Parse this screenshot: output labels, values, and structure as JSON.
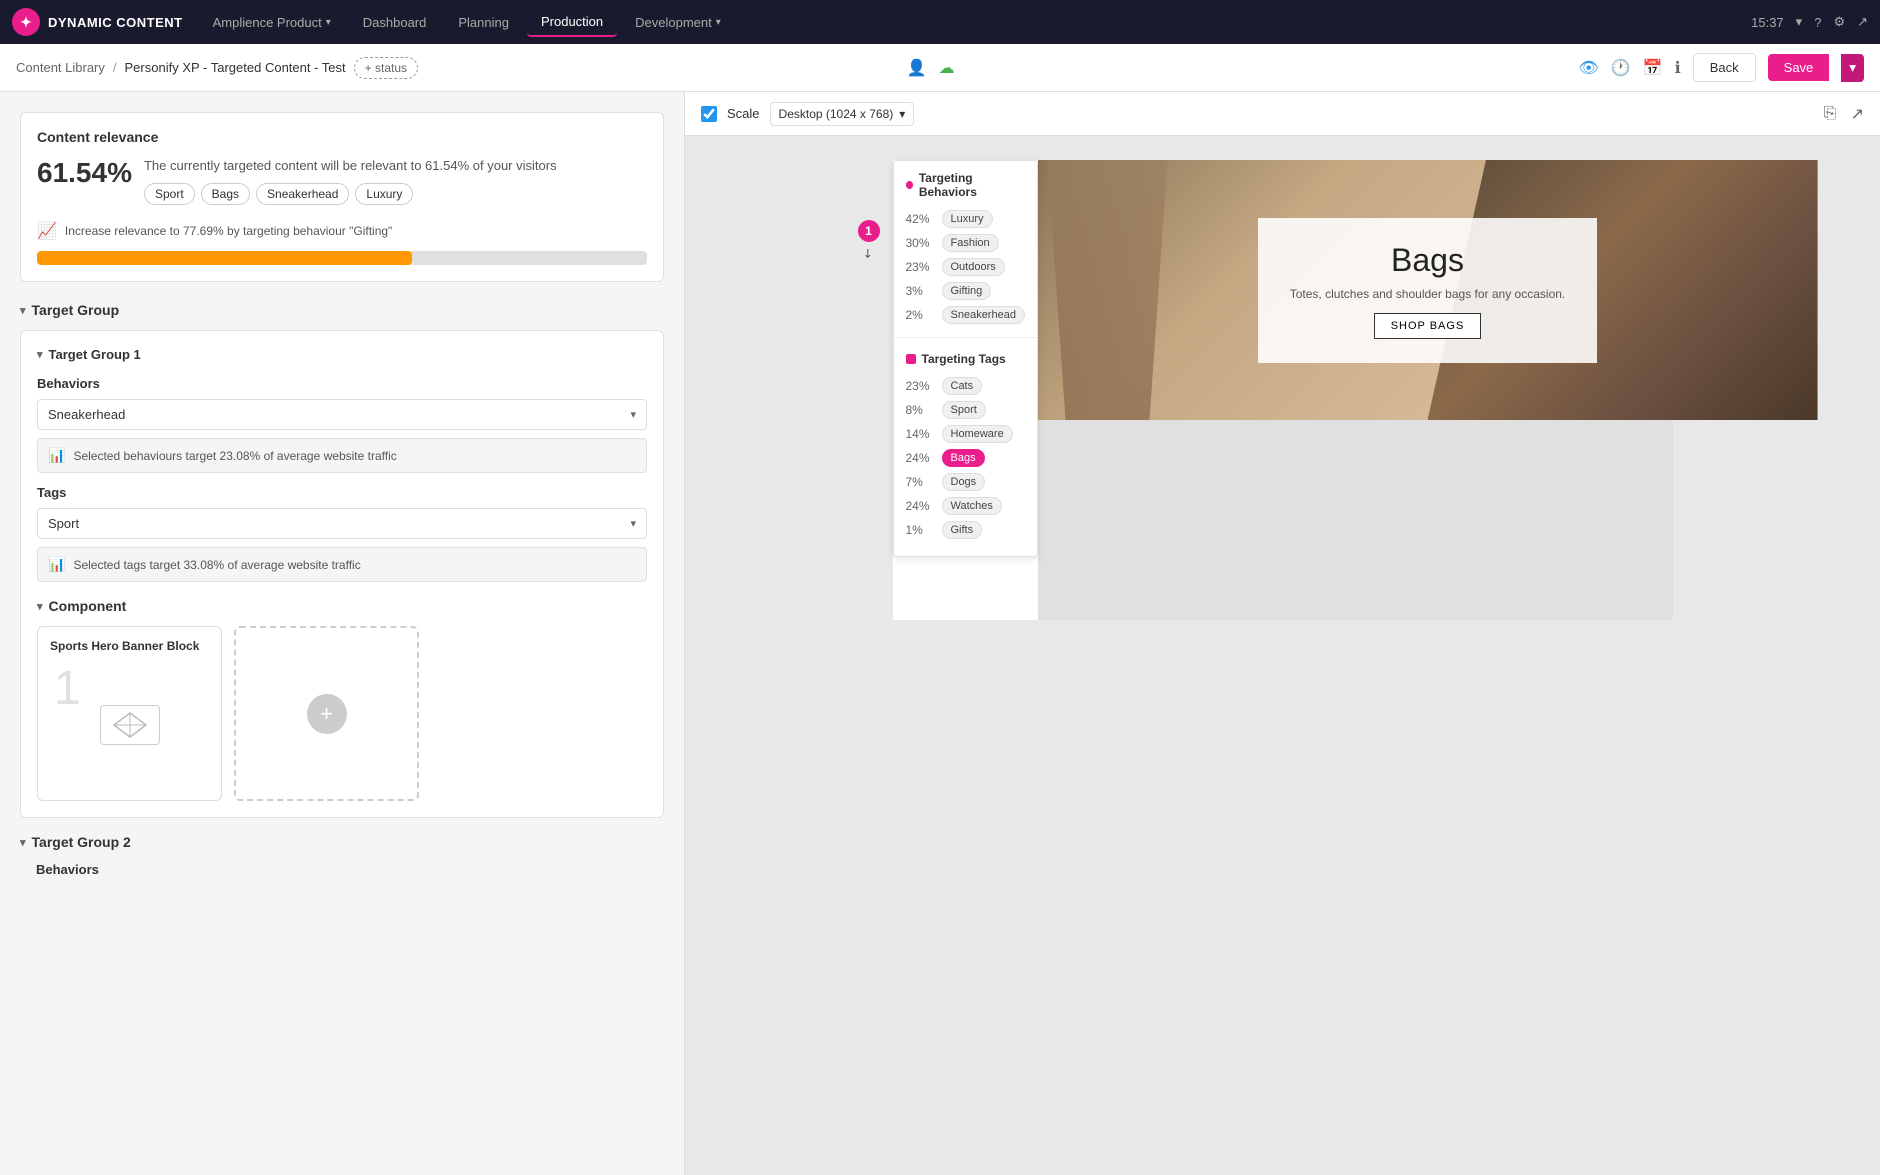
{
  "app": {
    "logo_text": "DYNAMIC CONTENT",
    "nav_items": [
      {
        "label": "Amplience Product",
        "active": false,
        "has_chevron": true
      },
      {
        "label": "Dashboard",
        "active": false
      },
      {
        "label": "Planning",
        "active": false
      },
      {
        "label": "Production",
        "active": true
      },
      {
        "label": "Development",
        "active": false,
        "has_chevron": true
      }
    ],
    "time": "15:37",
    "breadcrumb": {
      "library": "Content Library",
      "sep1": "/",
      "personify": "Personify XP - Targeted Content - Test",
      "status": "+ status"
    },
    "toolbar_right": {
      "back": "Back",
      "save": "Save"
    }
  },
  "left_panel": {
    "relevance": {
      "title": "Content relevance",
      "percent": "61.54%",
      "description": "The currently targeted content will be relevant to 61.54% of your visitors",
      "tags": [
        "Sport",
        "Bags",
        "Sneakerhead",
        "Luxury"
      ],
      "improve_text": "Increase relevance to 77.69% by targeting behaviour \"Gifting\"",
      "progress_fill_pct": 61.54
    },
    "target_group_label": "Target Group",
    "target_group_1": {
      "label": "Target Group 1",
      "behaviors_label": "Behaviors",
      "behaviors_value": "Sneakerhead",
      "behaviors_info": "Selected behaviours target 23.08% of average website traffic",
      "tags_label": "Tags",
      "tags_value": "Sport",
      "tags_info": "Selected tags target 33.08% of average website traffic",
      "component_label": "Component",
      "component_card_title": "Sports Hero Banner Block",
      "add_card_label": "+"
    },
    "target_group_2": {
      "label": "Target Group 2",
      "behaviors_label": "Behaviors"
    }
  },
  "right_panel": {
    "scale_label": "Scale",
    "device_label": "Desktop (1024 x 768)",
    "targeting_behaviors": {
      "title": "Targeting Behaviors",
      "items": [
        {
          "pct": "42%",
          "label": "Luxury"
        },
        {
          "pct": "30%",
          "label": "Fashion"
        },
        {
          "pct": "23%",
          "label": "Outdoors"
        },
        {
          "pct": "3%",
          "label": "Gifting"
        },
        {
          "pct": "2%",
          "label": "Sneakerhead"
        }
      ]
    },
    "targeting_tags": {
      "title": "Targeting Tags",
      "items": [
        {
          "pct": "23%",
          "label": "Cats",
          "active": false
        },
        {
          "pct": "8%",
          "label": "Sport",
          "active": false
        },
        {
          "pct": "14%",
          "label": "Homeware",
          "active": false
        },
        {
          "pct": "24%",
          "label": "Bags",
          "active": true
        },
        {
          "pct": "7%",
          "label": "Dogs",
          "active": false
        },
        {
          "pct": "24%",
          "label": "Watches",
          "active": false
        },
        {
          "pct": "1%",
          "label": "Gifts",
          "active": false
        }
      ]
    },
    "hero": {
      "title": "Bags",
      "subtitle": "Totes, clutches and shoulder bags for any occasion.",
      "cta": "SHOP BAGS"
    },
    "badge_number": "1"
  }
}
